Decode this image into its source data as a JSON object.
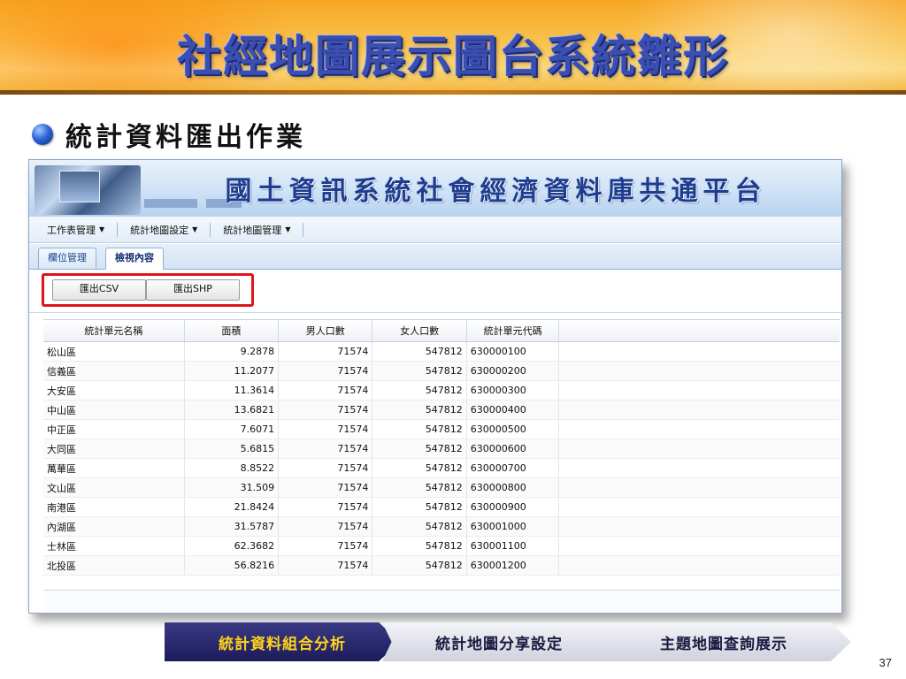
{
  "slide": {
    "title": "社經地圖展示圖台系統雛形",
    "section_title": "統計資料匯出作業",
    "page_number": "37"
  },
  "app": {
    "banner_title": "國土資訊系統社會經濟資料庫共通平台",
    "menu": [
      {
        "label": "工作表管理"
      },
      {
        "label": "統計地圖設定"
      },
      {
        "label": "統計地圖管理"
      }
    ],
    "tabs": [
      {
        "label": "欄位管理",
        "active": false
      },
      {
        "label": "檢視內容",
        "active": true
      }
    ],
    "toolbar": {
      "export_csv_label": "匯出CSV",
      "export_shp_label": "匯出SHP"
    },
    "table": {
      "headers": [
        "統計單元名稱",
        "面積",
        "男人口數",
        "女人口數",
        "統計單元代碼"
      ],
      "rows": [
        [
          "松山區",
          "9.2878",
          "71574",
          "547812",
          "630000100"
        ],
        [
          "信義區",
          "11.2077",
          "71574",
          "547812",
          "630000200"
        ],
        [
          "大安區",
          "11.3614",
          "71574",
          "547812",
          "630000300"
        ],
        [
          "中山區",
          "13.6821",
          "71574",
          "547812",
          "630000400"
        ],
        [
          "中正區",
          "7.6071",
          "71574",
          "547812",
          "630000500"
        ],
        [
          "大同區",
          "5.6815",
          "71574",
          "547812",
          "630000600"
        ],
        [
          "萬華區",
          "8.8522",
          "71574",
          "547812",
          "630000700"
        ],
        [
          "文山區",
          "31.509",
          "71574",
          "547812",
          "630000800"
        ],
        [
          "南港區",
          "21.8424",
          "71574",
          "547812",
          "630000900"
        ],
        [
          "內湖區",
          "31.5787",
          "71574",
          "547812",
          "630001000"
        ],
        [
          "士林區",
          "62.3682",
          "71574",
          "547812",
          "630001100"
        ],
        [
          "北投區",
          "56.8216",
          "71574",
          "547812",
          "630001200"
        ]
      ]
    }
  },
  "flow": [
    {
      "label": "統計資料組合分析",
      "active": true
    },
    {
      "label": "統計地圖分享設定",
      "active": false
    },
    {
      "label": "主題地圖查詢展示",
      "active": false
    }
  ],
  "colors": {
    "title_blue": "#3b4fb0",
    "highlight_red": "#e0141b",
    "active_step_bg": "#2a2a70",
    "active_step_text": "#ffd21a"
  },
  "icons": {
    "bullet": "bullet-ball-icon",
    "menu_caret": "caret-down-icon"
  }
}
